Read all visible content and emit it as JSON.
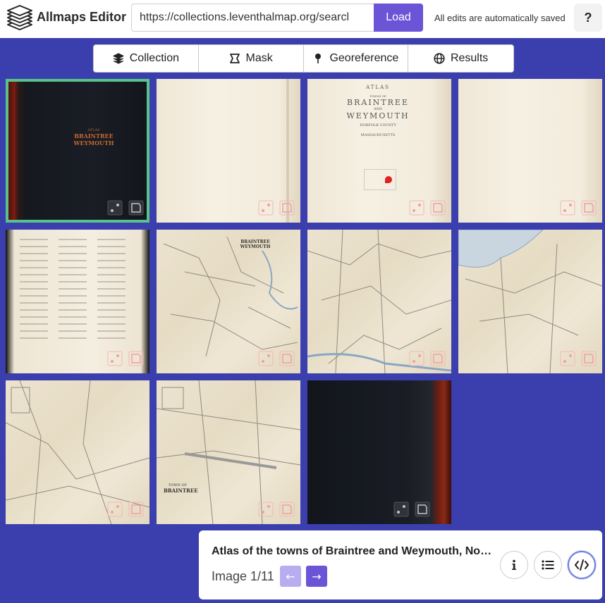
{
  "header": {
    "app_title": "Allmaps Editor",
    "url_value": "https://collections.leventhalmap.org/searcl",
    "load_label": "Load",
    "saved_text": "All edits are automatically saved",
    "help_label": "?"
  },
  "tabs": [
    {
      "label": "Collection",
      "icon": "layers-icon"
    },
    {
      "label": "Mask",
      "icon": "mask-icon"
    },
    {
      "label": "Georeference",
      "icon": "pin-icon"
    },
    {
      "label": "Results",
      "icon": "globe-icon"
    }
  ],
  "thumbnails": {
    "selected_index": 0,
    "count": 11,
    "cover_title_lines": [
      "ATLAS",
      "BRAINTREE",
      "WEYMOUTH"
    ],
    "title_page_lines": [
      "ATLAS",
      "TOWNS OF",
      "BRAINTREE",
      "AND",
      "WEYMOUTH",
      "NORFOLK COUNTY",
      "MASSACHUSETTS"
    ],
    "map_title_lines": [
      "BRAINTREE",
      "WEYMOUTH"
    ],
    "town_title_lines": [
      "TOWN OF",
      "BRAINTREE"
    ]
  },
  "info_panel": {
    "title": "Atlas of the towns of Braintree and Weymouth, Norfolk County, Massachusetts",
    "counter": "Image 1/11",
    "prev_label": "←",
    "next_label": "→"
  }
}
